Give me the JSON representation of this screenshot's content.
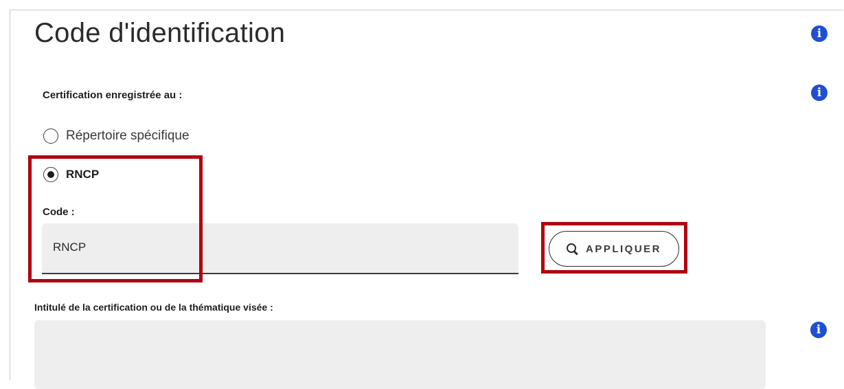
{
  "section": {
    "title": "Code d'identification"
  },
  "registration": {
    "label": "Certification enregistrée au :",
    "options": [
      {
        "label": "Répertoire spécifique",
        "selected": false
      },
      {
        "label": "RNCP",
        "selected": true
      }
    ]
  },
  "code": {
    "label": "Code :",
    "value": "RNCP"
  },
  "apply_button": {
    "label": "APPLIQUER",
    "icon": "search-icon"
  },
  "intitule": {
    "label": "Intitulé de la certification ou de la thématique visée :",
    "value": ""
  },
  "colors": {
    "info_icon": "#1f4fd1",
    "highlight": "#b00010",
    "field_background": "#eeeeee"
  }
}
